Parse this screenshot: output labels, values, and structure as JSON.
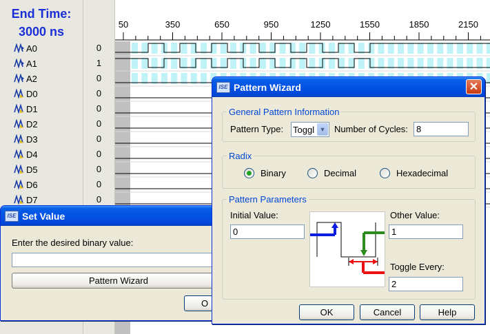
{
  "header": {
    "end_time_label": "End Time:",
    "end_time_value": "3000 ns"
  },
  "timeline": {
    "ticks": [
      "50",
      "350",
      "650",
      "950",
      "1250",
      "1550",
      "1850",
      "2150"
    ]
  },
  "signals": [
    {
      "name": "A0",
      "value": "0"
    },
    {
      "name": "A1",
      "value": "1"
    },
    {
      "name": "A2",
      "value": "0"
    },
    {
      "name": "D0",
      "value": "0"
    },
    {
      "name": "D1",
      "value": "0"
    },
    {
      "name": "D2",
      "value": "0"
    },
    {
      "name": "D3",
      "value": "0"
    },
    {
      "name": "D4",
      "value": "0"
    },
    {
      "name": "D5",
      "value": "0"
    },
    {
      "name": "D6",
      "value": "0"
    },
    {
      "name": "D7",
      "value": "0"
    }
  ],
  "set_value": {
    "logo": "ISE",
    "title": "Set Value",
    "prompt": "Enter the desired binary value:",
    "input_value": "",
    "pattern_button": "Pattern Wizard",
    "ok_button": "O"
  },
  "pattern_wizard": {
    "logo": "ISE",
    "title": "Pattern Wizard",
    "close_label": "✕",
    "general_group": "General Pattern Information",
    "pattern_type_label": "Pattern Type:",
    "pattern_type_value": "Toggl",
    "num_cycles_label": "Number of Cycles:",
    "num_cycles_value": "8",
    "radix_group": "Radix",
    "radix_options": [
      "Binary",
      "Decimal",
      "Hexadecimal"
    ],
    "radix_selected": "Binary",
    "params_group": "Pattern Parameters",
    "initial_value_label": "Initial Value:",
    "initial_value": "0",
    "other_value_label": "Other Value:",
    "other_value": "1",
    "toggle_every_label": "Toggle Every:",
    "toggle_every_value": "2",
    "ok_button": "OK",
    "cancel_button": "Cancel",
    "help_button": "Help"
  },
  "colors": {
    "title_blue": "#1b2fd6",
    "group_title": "#0046d5",
    "wave_highlight": "#bff3f7",
    "blue_arrow": "#0a1ee0",
    "green_arrow": "#2b8b1d",
    "red_arrow": "#ec1010"
  }
}
